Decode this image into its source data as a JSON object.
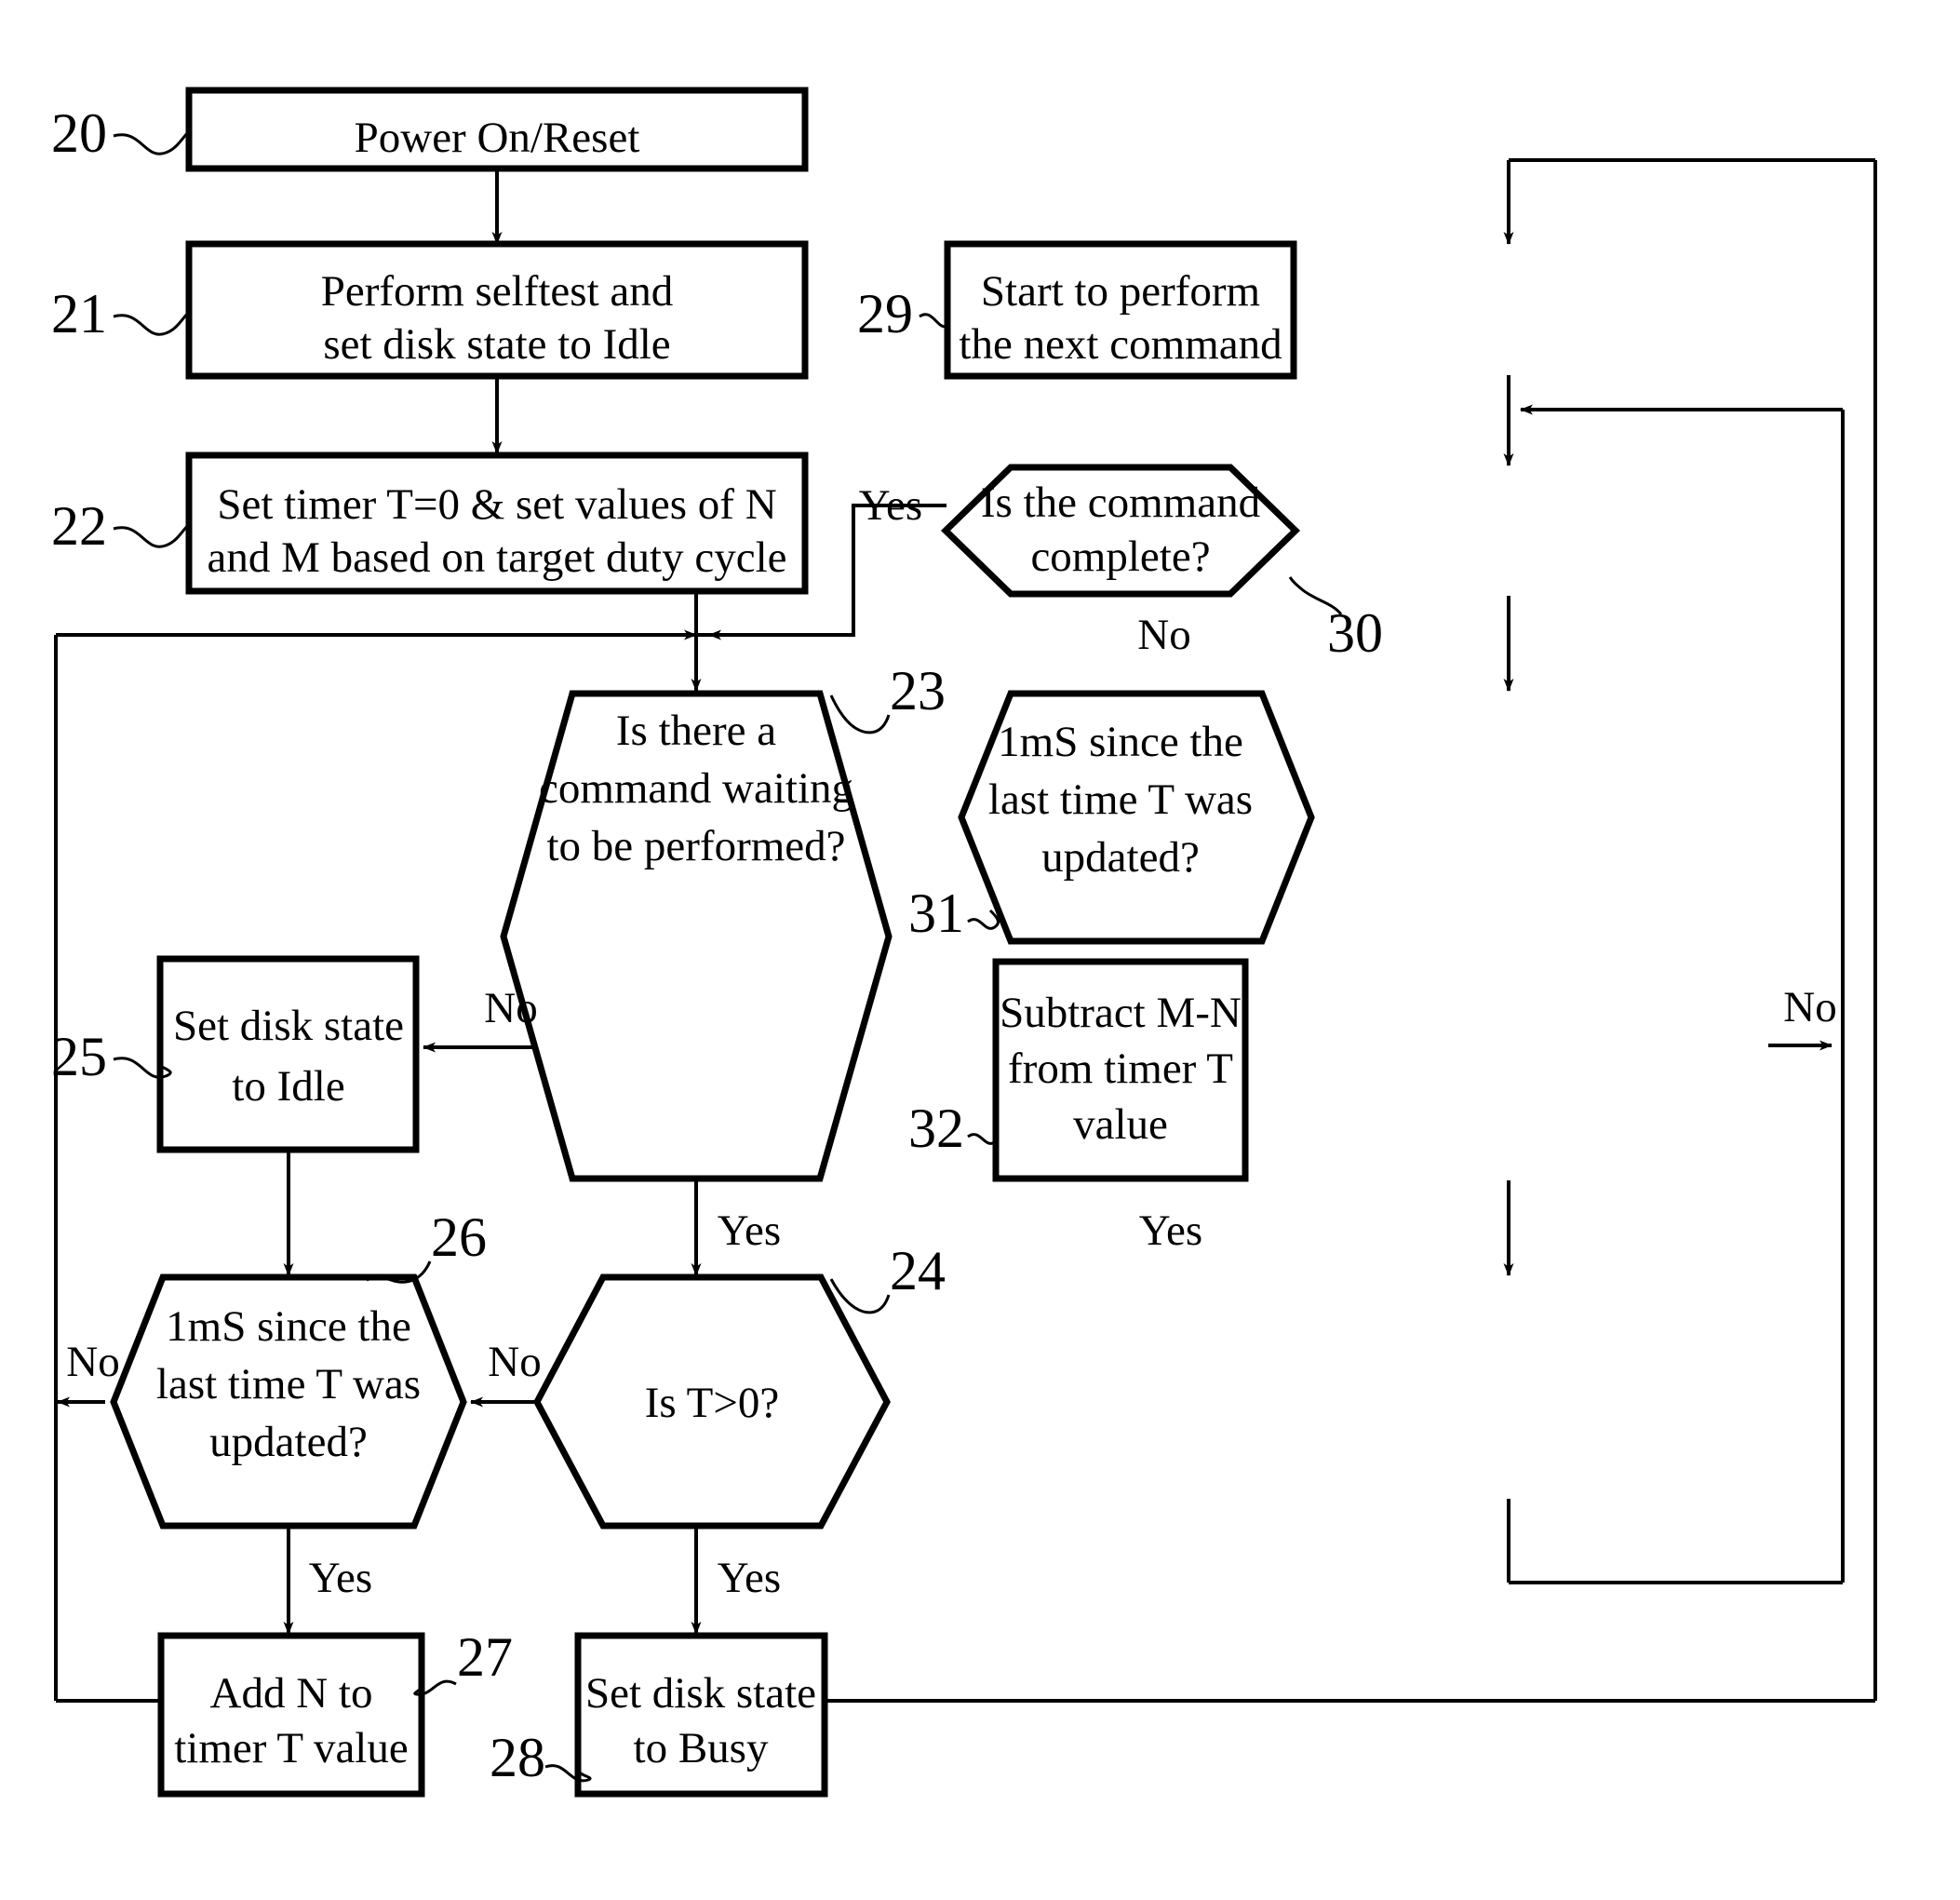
{
  "figure": {
    "type": "flowchart",
    "title": "",
    "background_color": "#ffffff",
    "line_color": "#000000",
    "text_color": "#000000"
  },
  "nodes": [
    {
      "ref": "20",
      "shape": "process",
      "lines": [
        "Power On/Reset"
      ],
      "line1": "Power On/Reset",
      "line2": "",
      "line3": ""
    },
    {
      "ref": "21",
      "shape": "process",
      "lines": [
        "Perform selftest and",
        "set disk state to Idle"
      ],
      "line1": "Perform selftest and",
      "line2": "set disk state to Idle",
      "line3": ""
    },
    {
      "ref": "22",
      "shape": "process",
      "lines": [
        "Set timer T=0 & set values of N",
        "and M based on target duty cycle"
      ],
      "line1": "Set timer T=0 & set values of N",
      "line2": "and M based on target duty cycle",
      "line3": ""
    },
    {
      "ref": "23",
      "shape": "decision",
      "lines": [
        "Is there a",
        "command waiting",
        "to be performed?"
      ],
      "line1": "Is there a",
      "line2": "command waiting",
      "line3": "to be performed?"
    },
    {
      "ref": "24",
      "shape": "decision",
      "lines": [
        "Is T>0?"
      ],
      "line1": "Is T>0?",
      "line2": "",
      "line3": ""
    },
    {
      "ref": "25",
      "shape": "process",
      "lines": [
        "Set disk state",
        "to Idle"
      ],
      "line1": "Set disk state",
      "line2": "to Idle",
      "line3": ""
    },
    {
      "ref": "26",
      "shape": "decision",
      "lines": [
        "1mS since the",
        "last time T was",
        "updated?"
      ],
      "line1": "1mS since the",
      "line2": "last time T was",
      "line3": "updated?"
    },
    {
      "ref": "27",
      "shape": "process",
      "lines": [
        "Add N to",
        "timer T value"
      ],
      "line1": "Add N to",
      "line2": "timer T value",
      "line3": ""
    },
    {
      "ref": "28",
      "shape": "process",
      "lines": [
        "Set disk state",
        "to Busy"
      ],
      "line1": "Set disk state",
      "line2": "to Busy",
      "line3": ""
    },
    {
      "ref": "29",
      "shape": "process",
      "lines": [
        "Start to perform",
        "the next command"
      ],
      "line1": "Start to perform",
      "line2": "the next command",
      "line3": ""
    },
    {
      "ref": "30",
      "shape": "decision",
      "lines": [
        "Is the command",
        "complete?"
      ],
      "line1": "Is the command",
      "line2": "complete?",
      "line3": ""
    },
    {
      "ref": "31",
      "shape": "decision",
      "lines": [
        "1mS since the",
        "last time T was",
        "updated?"
      ],
      "line1": "1mS since the",
      "line2": "last time T was",
      "line3": "updated?"
    },
    {
      "ref": "32",
      "shape": "process",
      "lines": [
        "Subtract M-N",
        "from timer T",
        "value"
      ],
      "line1": "Subtract M-N",
      "line2": "from timer T",
      "line3": "value"
    }
  ],
  "ref_numbers": {
    "n20": "20",
    "n21": "21",
    "n22": "22",
    "n23": "23",
    "n24": "24",
    "n25": "25",
    "n26": "26",
    "n27": "27",
    "n28": "28",
    "n29": "29",
    "n30": "30",
    "n31": "31",
    "n32": "32"
  },
  "edge_labels": {
    "e30_yes": "Yes",
    "e30_no": "No",
    "e23_no": "No",
    "e23_yes": "Yes",
    "e31_no": "No",
    "e31_yes": "Yes",
    "e26_no": "No",
    "e26_yes": "Yes",
    "e24_no": "No",
    "e24_yes": "Yes"
  }
}
